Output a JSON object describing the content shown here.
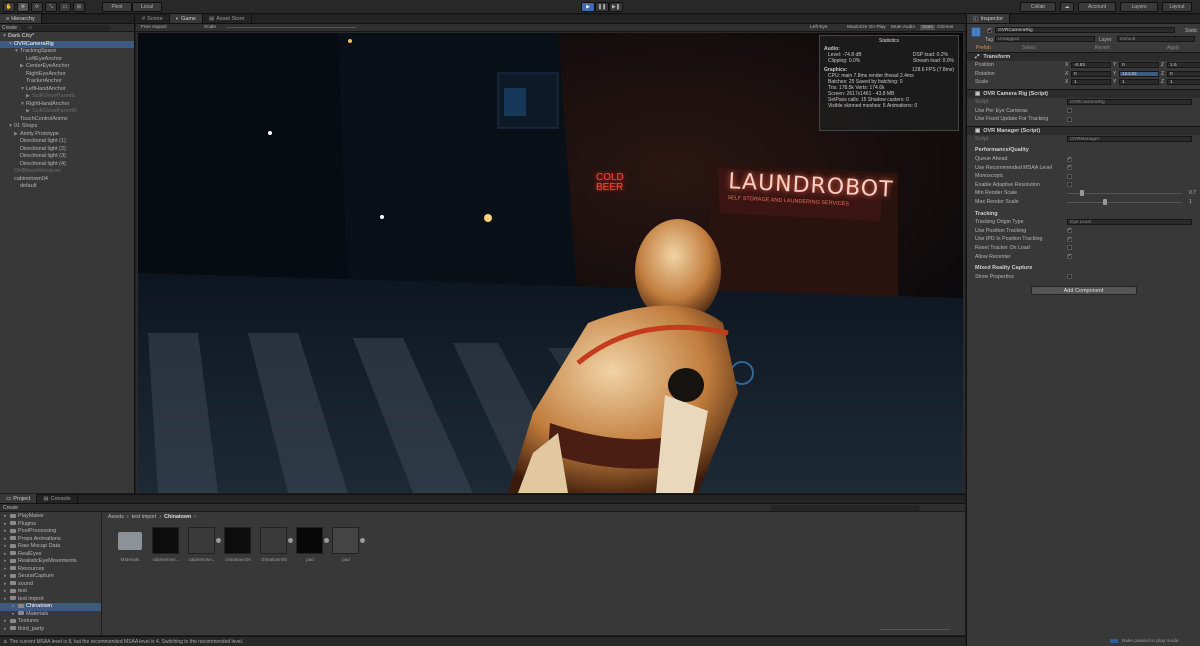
{
  "toolbar": {
    "pivot": "Pivot",
    "local": "Local",
    "collab": "Collab",
    "account": "Account",
    "layers": "Layers",
    "layout": "Layout"
  },
  "hierarchy": {
    "tab": "Hierarchy",
    "create": "Create",
    "search": "All",
    "items": [
      {
        "label": "Dark City*",
        "indent": 0,
        "arrow": "▼",
        "style": "bold"
      },
      {
        "label": "OVRCameraRig",
        "indent": 1,
        "arrow": "▼",
        "style": "sel"
      },
      {
        "label": "TrackingSpace",
        "indent": 2,
        "arrow": "▼",
        "style": ""
      },
      {
        "label": "LeftEyeAnchor",
        "indent": 3,
        "arrow": "",
        "style": ""
      },
      {
        "label": "CenterEyeAnchor",
        "indent": 3,
        "arrow": "▶",
        "style": ""
      },
      {
        "label": "RightEyeAnchor",
        "indent": 3,
        "arrow": "",
        "style": ""
      },
      {
        "label": "TrackerAnchor",
        "indent": 3,
        "arrow": "",
        "style": ""
      },
      {
        "label": "LeftHandAnchor",
        "indent": 3,
        "arrow": "▼",
        "style": ""
      },
      {
        "label": "ScifiGloveParentL",
        "indent": 4,
        "arrow": "▶",
        "style": "dim"
      },
      {
        "label": "RightHandAnchor",
        "indent": 3,
        "arrow": "▼",
        "style": ""
      },
      {
        "label": "ScifiGloveParentR",
        "indent": 4,
        "arrow": "▶",
        "style": "dim"
      },
      {
        "label": "TouchControlAnims",
        "indent": 2,
        "arrow": "",
        "style": ""
      },
      {
        "label": "01 Shops",
        "indent": 1,
        "arrow": "▼",
        "style": ""
      },
      {
        "label": "Amity Prototype",
        "indent": 2,
        "arrow": "▶",
        "style": ""
      },
      {
        "label": "Directional light (1)",
        "indent": 2,
        "arrow": "",
        "style": ""
      },
      {
        "label": "Directional light (2)",
        "indent": 2,
        "arrow": "",
        "style": ""
      },
      {
        "label": "Directional light (3)",
        "indent": 2,
        "arrow": "",
        "style": ""
      },
      {
        "label": "Directional light (4)",
        "indent": 2,
        "arrow": "",
        "style": ""
      },
      {
        "label": "DirtBloomRenderer",
        "indent": 1,
        "arrow": "",
        "style": "dim"
      },
      {
        "label": "cabinetown04",
        "indent": 1,
        "arrow": "",
        "style": ""
      },
      {
        "label": "default",
        "indent": 2,
        "arrow": "",
        "style": ""
      }
    ]
  },
  "center_tabs": {
    "scene": "Scene",
    "game": "Game",
    "asset_store": "Asset Store"
  },
  "game": {
    "aspect": "Free Aspect",
    "scale": "Scale",
    "left_eye": "Left Eye",
    "maximize": "Maximize On Play",
    "mute": "Mute Audio",
    "stats": "Stats",
    "gizmos": "Gizmos"
  },
  "stats": {
    "title": "Statistics",
    "audio_head": "Audio:",
    "audio_l": [
      "Level: -74.8 dB",
      "Clipping: 0.0%"
    ],
    "audio_r": [
      "DSP load: 0.2%",
      "Stream load: 0.0%"
    ],
    "graphics_head": "Graphics:",
    "fps": "128.6 FPS (7.8ms)",
    "lines": [
      "CPU: main 7.8ms  render thread 2.4ms",
      "Batches: 25        Saved by batching: 0",
      "Tris: 178.5k          Verts: 174.6k",
      "Screen: 2617x1461 - 43.8 MB",
      "SetPass calls: 15     Shadow casters: 0",
      "Visible skinned meshes: 5  Animations: 0"
    ]
  },
  "scene_text": {
    "sign": "LAUNDROBOT",
    "sign_sub": "SELF STORAGE AND LAUNDERING SERVICES",
    "neon1": "COLD",
    "neon2": "BEER"
  },
  "project": {
    "tab": "Project",
    "console": "Console",
    "create": "Create",
    "breadcrumb": [
      "Assets",
      "test import",
      "Chinatown"
    ],
    "folders": [
      {
        "label": "PlayMaker",
        "indent": 0,
        "style": ""
      },
      {
        "label": "Plugins",
        "indent": 0,
        "style": ""
      },
      {
        "label": "PostProcessing",
        "indent": 0,
        "style": ""
      },
      {
        "label": "Props Animations",
        "indent": 0,
        "style": ""
      },
      {
        "label": "Raw Mocap Data",
        "indent": 0,
        "style": ""
      },
      {
        "label": "RealEyes",
        "indent": 0,
        "style": ""
      },
      {
        "label": "RealisticEyeMovements",
        "indent": 0,
        "style": ""
      },
      {
        "label": "Resources",
        "indent": 0,
        "style": ""
      },
      {
        "label": "SeuratCapture",
        "indent": 0,
        "style": ""
      },
      {
        "label": "sound",
        "indent": 0,
        "style": ""
      },
      {
        "label": "test",
        "indent": 0,
        "style": ""
      },
      {
        "label": "test import",
        "indent": 0,
        "style": ""
      },
      {
        "label": "Chinatown",
        "indent": 1,
        "style": "sel"
      },
      {
        "label": "Materials",
        "indent": 1,
        "style": ""
      },
      {
        "label": "Textures",
        "indent": 0,
        "style": ""
      },
      {
        "label": "third_party",
        "indent": 0,
        "style": ""
      }
    ],
    "assets": [
      "Materials",
      "cabinetown...",
      "cabinetown...",
      "chinatown00",
      "chinatown00",
      "pad",
      "pad"
    ]
  },
  "inspector": {
    "tab": "Inspector",
    "object_name": "OVRCameraRig",
    "static": "Static",
    "tag_label": "Tag",
    "tag": "Untagged",
    "layer_label": "Layer",
    "layer": "Default",
    "prefab": "Prefab",
    "select": "Select",
    "revert": "Revert",
    "apply": "Apply",
    "transform": "Transform",
    "position": {
      "label": "Position",
      "x": "-0.93",
      "y": "0",
      "z": "1.6"
    },
    "rotation": {
      "label": "Rotation",
      "x": "0",
      "y": "124.82",
      "z": "0"
    },
    "scale": {
      "label": "Scale",
      "x": "1",
      "y": "1",
      "z": "1"
    },
    "camrig": "OVR Camera Rig (Script)",
    "script_label": "Script",
    "camrig_script": "OVRCameraRig",
    "per_eye": "Use Per Eye Cameras",
    "fixed_update": "Use Fixed Update For Tracking",
    "manager": "OVR Manager (Script)",
    "manager_script": "OVRManager",
    "perf": "Performance/Quality",
    "perf_rows": [
      {
        "label": "Queue Ahead",
        "checked": true
      },
      {
        "label": "Use Recommended MSAA Level",
        "checked": true
      },
      {
        "label": "Monoscopic",
        "checked": false
      },
      {
        "label": "Enable Adaptive Resolution",
        "checked": false
      }
    ],
    "min_scale": "Min Render Scale",
    "min_val": "0.7",
    "max_scale": "Max Render Scale",
    "max_val": "1",
    "tracking": "Tracking",
    "origin": "Tracking Origin Type",
    "origin_val": "Eye Level",
    "track_rows": [
      {
        "label": "Use Position Tracking",
        "checked": true
      },
      {
        "label": "Use IPD In Position Tracking",
        "checked": true
      },
      {
        "label": "Reset Tracker On Load",
        "checked": false
      },
      {
        "label": "Allow Recenter",
        "checked": true
      }
    ],
    "mixed": "Mixed Reality Capture",
    "show_props": "Show Properties",
    "add_component": "Add Component"
  },
  "status": {
    "message": "The current MSAA level is 8, but the recommended MSAA level is 4. Switching to the recommended level.",
    "right": "Bake paused in play mode"
  }
}
